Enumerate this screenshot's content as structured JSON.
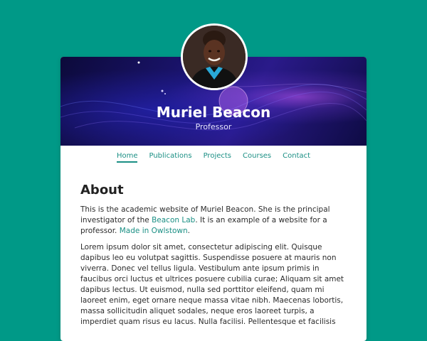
{
  "profile": {
    "name": "Muriel Beacon",
    "role": "Professor"
  },
  "nav": {
    "items": [
      "Home",
      "Publications",
      "Projects",
      "Courses",
      "Contact"
    ],
    "active": "Home"
  },
  "about": {
    "heading": "About",
    "intro_before_lab": "This is the academic website of Muriel Beacon. She is the principal investigator of the ",
    "lab_link": "Beacon Lab",
    "intro_after_lab": ". It is an example of a website for a professor. ",
    "made_link": "Made in Owlstown",
    "intro_end": ".",
    "lorem": "Lorem ipsum dolor sit amet, consectetur adipiscing elit. Quisque dapibus leo eu volutpat sagittis. Suspendisse posuere at mauris non viverra. Donec vel tellus ligula. Vestibulum ante ipsum primis in faucibus orci luctus et ultrices posuere cubilia curae; Aliquam sit amet dapibus lectus. Ut euismod, nulla sed porttitor eleifend, quam mi laoreet enim, eget ornare neque massa vitae nibh. Maecenas lobortis, massa sollicitudin aliquet sodales, neque eros laoreet turpis, a imperdiet quam risus eu lacus. Nulla facilisi. Pellentesque et facilisis"
  },
  "colors": {
    "background": "#009987",
    "accent": "#1a8f84"
  }
}
